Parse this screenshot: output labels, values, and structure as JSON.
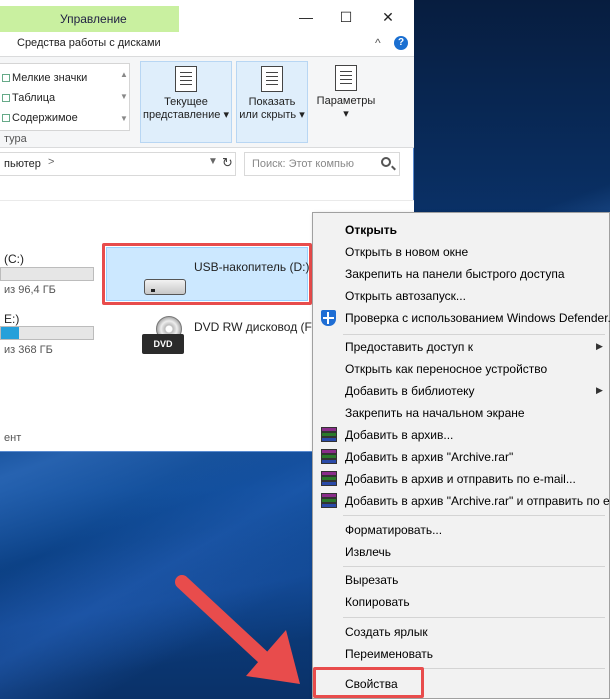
{
  "titlebar": {
    "contextual_tab": "Управление",
    "minimize": "—",
    "maximize": "☐",
    "close": "✕"
  },
  "ribbon": {
    "tab": "Средства работы с дисками",
    "help": "?",
    "layout_items": [
      "Мелкие значки",
      "Таблица",
      "Содержимое"
    ],
    "group_label": "тура",
    "current_view": [
      "Текущее",
      "представление"
    ],
    "show_hide": [
      "Показать",
      "или скрыть"
    ],
    "options": "Параметры",
    "dropdown_glyph": "▾"
  },
  "address": {
    "path": "пьютер",
    "separator": ">",
    "search_placeholder": "Поиск: Этот компью"
  },
  "drives": {
    "c_label": "(C:)",
    "c_free": "из 96,4 ГБ",
    "c_fill": 0.0,
    "e_label": "E:)",
    "e_free": "из 368 ГБ",
    "e_fill": 0.2,
    "usb_label": "USB-накопитель (D:)",
    "dvd_label": "DVD RW дисковод (F:",
    "dvd_badge": "DVD",
    "footer": "ент"
  },
  "context_menu": {
    "items": [
      {
        "label": "Открыть",
        "bold": true
      },
      {
        "label": "Открыть в новом окне"
      },
      {
        "label": "Закрепить на панели быстрого доступа"
      },
      {
        "label": "Открыть автозапуск..."
      },
      {
        "label": "Проверка с использованием Windows Defender...",
        "icon": "defender-shield-icon"
      },
      {
        "label": "Предоставить доступ к",
        "arrow": true
      },
      {
        "label": "Открыть как переносное устройство"
      },
      {
        "label": "Добавить в библиотеку",
        "arrow": true
      },
      {
        "label": "Закрепить на начальном экране"
      },
      {
        "label": "Добавить в архив...",
        "icon": "winrar-icon"
      },
      {
        "label": "Добавить в архив \"Archive.rar\"",
        "icon": "winrar-icon"
      },
      {
        "label": "Добавить в архив и отправить по e-mail...",
        "icon": "winrar-icon"
      },
      {
        "label": "Добавить в архив \"Archive.rar\" и отправить по e-mail",
        "icon": "winrar-icon"
      },
      {
        "label": "Форматировать..."
      },
      {
        "label": "Извлечь"
      },
      {
        "label": "Вырезать"
      },
      {
        "label": "Копировать"
      },
      {
        "label": "Создать ярлык"
      },
      {
        "label": "Переименовать"
      },
      {
        "label": "Свойства"
      }
    ],
    "arrow_glyph": "▶"
  },
  "colors": {
    "highlight": "#e84c4c",
    "selection": "#cce8ff",
    "contextual_tab": "#c9f0a0"
  }
}
